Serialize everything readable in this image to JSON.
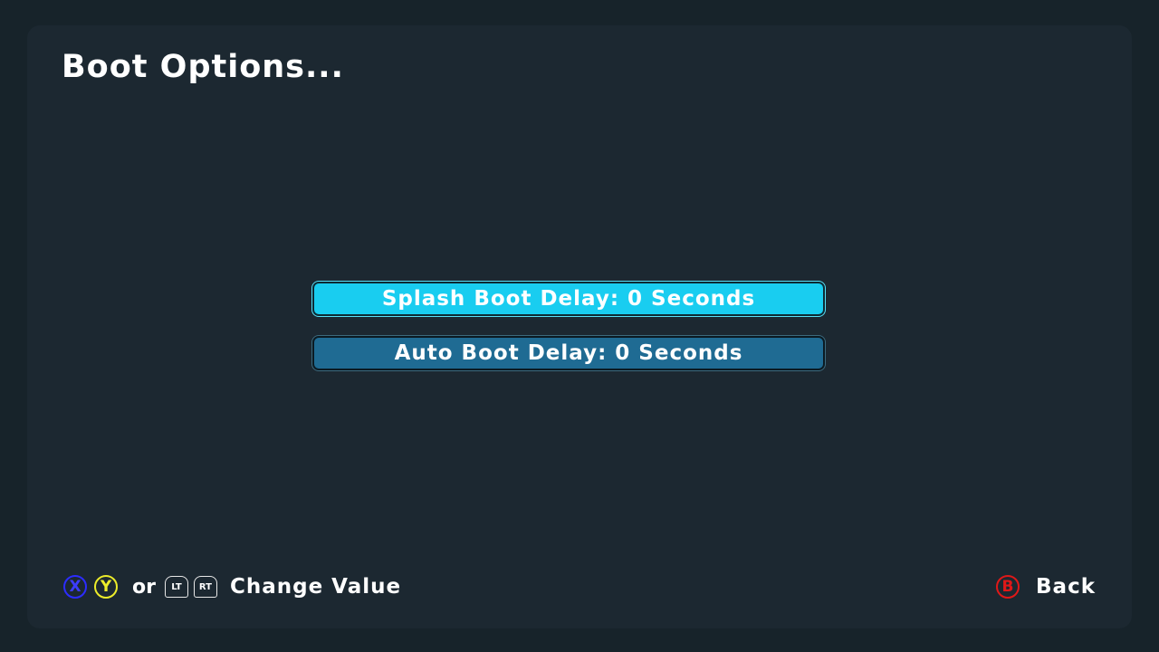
{
  "screen": {
    "title": "Boot Options..."
  },
  "menu": {
    "items": [
      {
        "label": "Splash Boot Delay: 0 Seconds",
        "selected": true
      },
      {
        "label": "Auto Boot Delay: 0 Seconds",
        "selected": false
      }
    ]
  },
  "footer": {
    "x_glyph": "X",
    "y_glyph": "Y",
    "or_text": "or",
    "lt_glyph": "LT",
    "rt_glyph": "RT",
    "change_value_label": "Change Value",
    "b_glyph": "B",
    "back_label": "Back"
  },
  "colors": {
    "background": "#17232a",
    "panel": "#1c2831",
    "selected_item": "#19cdf0",
    "normal_item": "#1f6b93",
    "x_button": "#2c2cff",
    "y_button": "#ecec2a",
    "b_button": "#e01818"
  },
  "icons": {
    "x_button": "x-button-icon",
    "y_button": "y-button-icon",
    "lt_trigger": "left-trigger-icon",
    "rt_trigger": "right-trigger-icon",
    "b_button": "b-button-icon"
  }
}
